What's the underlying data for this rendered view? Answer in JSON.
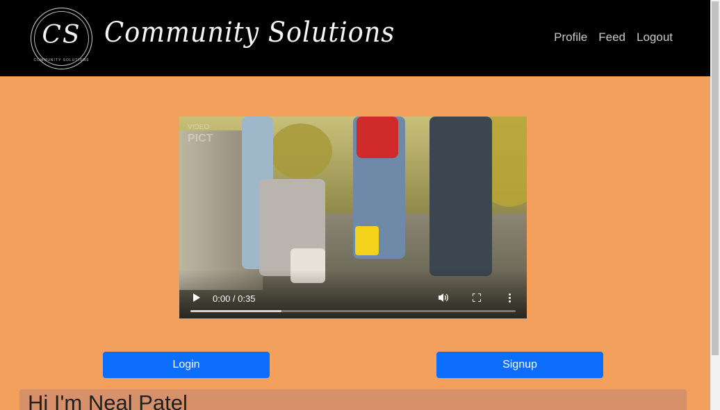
{
  "header": {
    "logo_monogram": "CS",
    "logo_small_text": "COMMUNITY SOLUTIONS",
    "brand": "Community Solutions",
    "nav": [
      {
        "label": "Profile"
      },
      {
        "label": "Feed"
      },
      {
        "label": "Logout"
      }
    ]
  },
  "video": {
    "watermark_top": "VIDEO",
    "watermark_bottom": "PICT",
    "time": "0:00 / 0:35",
    "progress_buffered": 0.28
  },
  "buttons": {
    "login": "Login",
    "signup": "Signup"
  },
  "intro": {
    "heading": "Hi I'm Neal Patel"
  },
  "colors": {
    "background": "#f2a05c",
    "header": "#000000",
    "button": "#0d6efd",
    "intro_card": "#d6906a"
  }
}
